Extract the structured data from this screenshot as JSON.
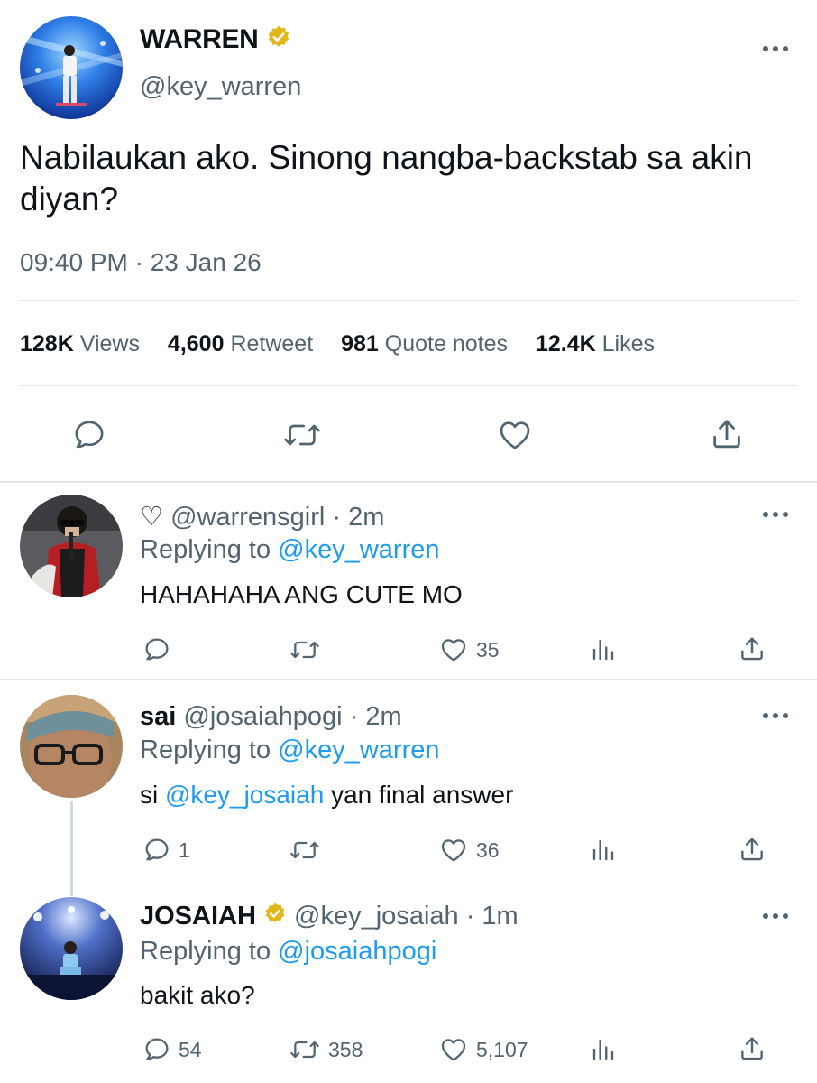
{
  "main_tweet": {
    "display_name": "WARREN",
    "handle": "@key_warren",
    "text": "Nabilaukan ako. Sinong nangba-backstab sa akin diyan?",
    "timestamp": "09:40 PM · 23 Jan 26",
    "stats": [
      {
        "value": "128K",
        "label": "Views"
      },
      {
        "value": "4,600",
        "label": "Retweet"
      },
      {
        "value": "981",
        "label": "Quote notes"
      },
      {
        "value": "12.4K",
        "label": "Likes"
      }
    ]
  },
  "replies": [
    {
      "name_prefix": "♡",
      "display_name": "",
      "handle": "@warrensgirl",
      "time": "· 2m",
      "replying_label": "Replying to",
      "replying_to": "@key_warren",
      "text_parts": [
        "HAHAHAHA ANG CUTE MO",
        "",
        ""
      ],
      "counts": {
        "reply": "",
        "retweet": "",
        "like": "35"
      }
    },
    {
      "name_prefix": "",
      "display_name": "sai",
      "handle": "@josaiahpogi",
      "time": "· 2m",
      "replying_label": "Replying to",
      "replying_to": "@key_warren",
      "text_parts": [
        "si ",
        "@key_josaiah",
        " yan final answer"
      ],
      "counts": {
        "reply": "1",
        "retweet": "",
        "like": "36"
      }
    },
    {
      "name_prefix": "",
      "display_name": "JOSAIAH",
      "handle": "@key_josaiah",
      "time": "· 1m",
      "replying_label": "Replying to",
      "replying_to": "@josaiahpogi",
      "text_parts": [
        "bakit ako?",
        "",
        ""
      ],
      "counts": {
        "reply": "54",
        "retweet": "358",
        "like": "5,107"
      }
    }
  ],
  "icons": {
    "reply": "reply-icon",
    "retweet": "retweet-icon",
    "like": "heart-icon",
    "views": "analytics-icon",
    "share": "share-icon",
    "more": "more-icon",
    "verified": "verified-badge-icon"
  },
  "colors": {
    "text": "#0f1419",
    "secondary": "#536471",
    "link": "#1d9bf0",
    "verified_gold": "#e2b719"
  }
}
